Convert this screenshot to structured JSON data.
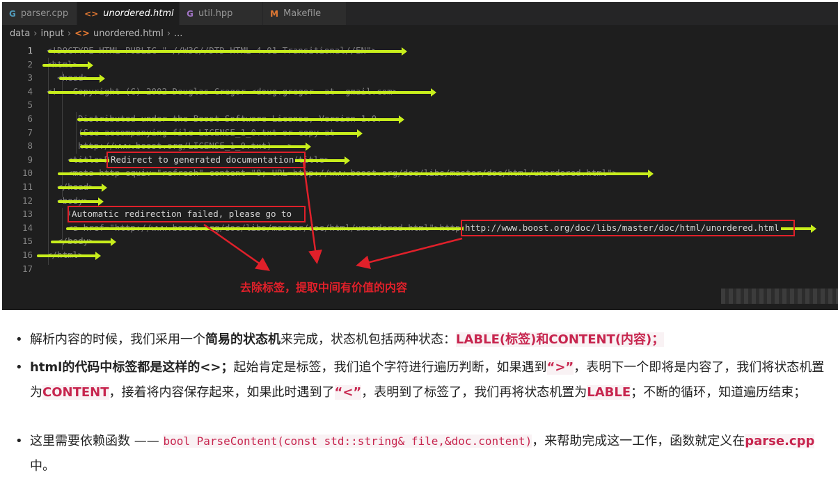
{
  "tabs": [
    {
      "icon": "cpp-icon",
      "glyph": "G",
      "color": "#519aba",
      "label": "parser.cpp",
      "active": false
    },
    {
      "icon": "html-icon",
      "glyph": "<>",
      "color": "#e37933",
      "label": "unordered.html",
      "active": true
    },
    {
      "icon": "hpp-icon",
      "glyph": "G",
      "color": "#a074c4",
      "label": "util.hpp",
      "active": false
    },
    {
      "icon": "makefile-icon",
      "glyph": "M",
      "color": "#e37933",
      "label": "Makefile",
      "active": false
    }
  ],
  "breadcrumb": [
    "data",
    "input",
    "unordered.html",
    "..."
  ],
  "code_lines": [
    {
      "num": "1",
      "text": "<!DOCTYPE HTML PUBLIC \"-//W3C//DTD HTML 4.01 Transitional//EN\">"
    },
    {
      "num": "2",
      "text": "<html>"
    },
    {
      "num": "3",
      "text": "  <head>"
    },
    {
      "num": "4",
      "text": "<!-- Copyright (C) 2002 Douglas Gregor <doug.gregor -at- gmail.com>"
    },
    {
      "num": "5",
      "text": ""
    },
    {
      "num": "6",
      "text": "      Distributed under the Boost Software License, Version 1.0."
    },
    {
      "num": "7",
      "text": "      (See accompanying file LICENSE_1_0.txt or copy at"
    },
    {
      "num": "8",
      "text": "      http://www.boost.org/LICENSE_1_0.txt) -->"
    },
    {
      "num": "9",
      "text": "    <title>Redirect to generated documentation</title>"
    },
    {
      "num": "10",
      "text": "    <meta http-equiv=\"refresh\" content=\"0; URL=http://www.boost.org/doc/libs/master/doc/html/unordered.html\">"
    },
    {
      "num": "11",
      "text": "  </head>"
    },
    {
      "num": "12",
      "text": "  <body>"
    },
    {
      "num": "13",
      "text": "    Automatic redirection failed, please go to"
    },
    {
      "num": "14",
      "text": "    <a href=\"http://www.boost.org/doc/libs/master/doc/html/unordered.html\">http://www.boost.org/doc/libs/master/doc/html/unordered.html</a>"
    },
    {
      "num": "15",
      "text": "  </body>"
    },
    {
      "num": "16",
      "text": "</html>"
    },
    {
      "num": "17",
      "text": ""
    }
  ],
  "highlights": {
    "title_text": "Redirect to generated documentation",
    "body_text": "Automatic redirection failed, please go to",
    "link_text": "http://www.boost.org/doc/libs/master/doc/html/unordered.html"
  },
  "annotation_caption": "去除标签，提取中间有价值的内容",
  "colors": {
    "strike": "#c8ee1c",
    "annotation_red": "#e0202a",
    "emphasis": "#c7254e"
  },
  "notes": {
    "n1": {
      "a": "解析内容的时候，我们采用一个",
      "b": "简易的状态机",
      "c": "来完成，状态机包括两种状态：",
      "d": "LABLE(标签)和CONTENT(内容)；"
    },
    "n2": {
      "a": "html的代码中标签都是这样的<>；",
      "b": "起始肯定是标签，我们追个字符进行遍历判断，如果遇到",
      "c": "“>”",
      "d": "，表明下一个即将是内容了，我们将状态机置为",
      "e": "CONTENT",
      "f": "，接着将内容保存起来，如果此时遇到了",
      "g": "“<”",
      "h": "，表明到了标签了，我们再将状态机置为",
      "i": "LABLE",
      "j": "；不断的循环，知道遍历结束；"
    },
    "n3": {
      "a": "这里需要依赖函数 —— ",
      "b": "bool ParseContent(const std::string& file,&doc.content)",
      "c": "，来帮助完成这一工作，函数就定义在",
      "d": "parse.cpp",
      "e": "中。"
    }
  },
  "bullet": "•"
}
